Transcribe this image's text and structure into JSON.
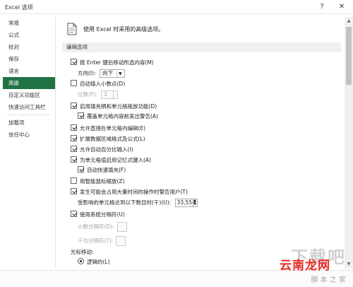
{
  "window": {
    "title": "Excel 选项",
    "help": "?",
    "close": "✕"
  },
  "sidebar": {
    "items": [
      {
        "label": "常规"
      },
      {
        "label": "公式"
      },
      {
        "label": "校对"
      },
      {
        "label": "保存"
      },
      {
        "label": "语言"
      },
      {
        "label": "高级"
      },
      {
        "label": "自定义功能区"
      },
      {
        "label": "快速访问工具栏"
      },
      {
        "label": "加载项"
      },
      {
        "label": "信任中心"
      }
    ],
    "selected": "高级",
    "accent_color": "#217346"
  },
  "header": {
    "text": "使用 Excel 时采用的高级选项。",
    "icon": "document-icon"
  },
  "section": {
    "title": "编辑选项"
  },
  "options": {
    "enter_move": {
      "label": "按 Enter 键后移动所选内容(M)",
      "checked": true
    },
    "direction": {
      "label": "方向(I):",
      "value": "向下"
    },
    "auto_decimal": {
      "label": "自动插入小数点(D)",
      "checked": false
    },
    "places": {
      "label": "位数(P):",
      "value": "2"
    },
    "fill_handle": {
      "label": "启用填充柄和单元格拖放功能(D)",
      "checked": true
    },
    "overwrite_alert": {
      "label": "覆盖单元格内容前发出警告(A)",
      "checked": true
    },
    "edit_in_cell": {
      "label": "允许直接在单元格内编辑(E)",
      "checked": true
    },
    "extend_formats": {
      "label": "扩展数据区域格式及公式(L)",
      "checked": true
    },
    "auto_percent": {
      "label": "允许自动百分比输入(I)",
      "checked": true
    },
    "autocomplete": {
      "label": "为单元格值启用记忆式键入(A)",
      "checked": true
    },
    "flash_fill": {
      "label": "自动快速填充(F)",
      "checked": true
    },
    "zoom_roll": {
      "label": "用智能鼠标缩放(Z)",
      "checked": false
    },
    "alert_slow": {
      "label": "发生可能会占用大量时间的操作时警告用户(T)",
      "checked": true
    },
    "cells_affected": {
      "label": "受影响的单元格达到以下数目时(千)(U):",
      "value": "33,554"
    },
    "system_separators": {
      "label": "使用系统分隔符(U)",
      "checked": true
    },
    "decimal_sep": {
      "label": "小数分隔符(D):"
    },
    "thousands_sep": {
      "label": "千位分隔符(T):"
    },
    "cursor_movement": {
      "label": "光标移动:"
    },
    "logical": {
      "label": "逻辑的(L)",
      "checked": true
    }
  },
  "watermark": {
    "big": "下载吧",
    "label": "云南龙网",
    "sub": "脚 本 之 家"
  }
}
